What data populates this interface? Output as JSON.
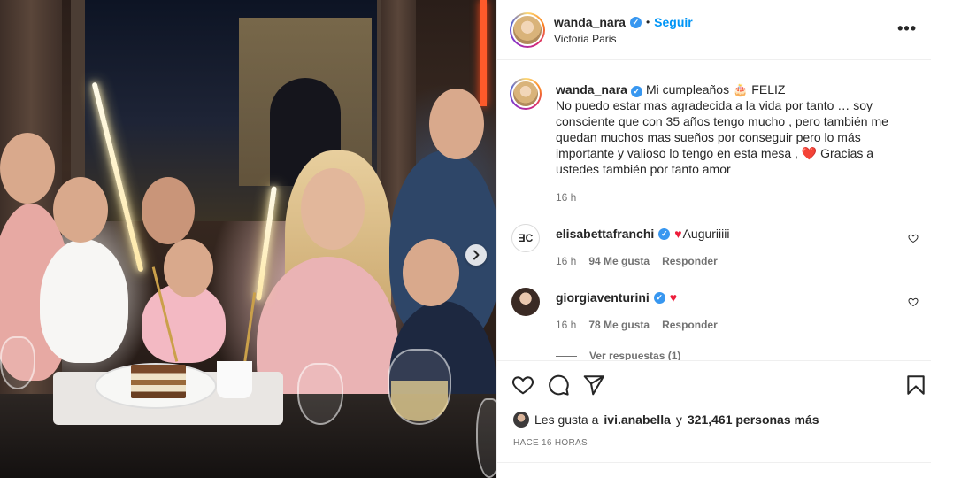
{
  "post": {
    "username": "wanda_nara",
    "follow_label": "Seguir",
    "separator": "•",
    "location": "Victoria Paris",
    "more_label": "•••"
  },
  "caption": {
    "username": "wanda_nara",
    "text": "Mi cumpleaños 🎂 FELIZ\nNo puedo estar mas agradecida a la vida por tanto … soy consciente que con 35 años tengo mucho , pero también me quedan muchos mas sueños por conseguir pero lo más importante y valioso lo tengo en esta mesa , ❤️ Gracias a ustedes también por tanto amor",
    "time": "16 h"
  },
  "comments": [
    {
      "username": "elisabettafranchi",
      "avatar_text": "ƎC",
      "heart": "♥",
      "text": "Auguriiiii",
      "time": "16 h",
      "likes": "94 Me gusta",
      "reply_label": "Responder"
    },
    {
      "username": "giorgiaventurini",
      "heart": "♥",
      "text": "",
      "time": "16 h",
      "likes": "78 Me gusta",
      "reply_label": "Responder"
    }
  ],
  "view_replies_label": "Ver respuestas (1)",
  "likes": {
    "prefix": "Les gusta a",
    "user": "ivi.anabella",
    "connector": "y",
    "others": "321,461 personas más"
  },
  "date_label": "HACE 16 HORAS",
  "icons": {
    "verified": "verified-badge-icon",
    "like": "heart-icon",
    "comment": "comment-icon",
    "share": "share-icon",
    "save": "bookmark-icon",
    "next": "chevron-right-icon"
  },
  "colors": {
    "follow": "#0095f6",
    "verified": "#3897f0",
    "heart": "#ed1c3a",
    "muted": "#737373"
  }
}
